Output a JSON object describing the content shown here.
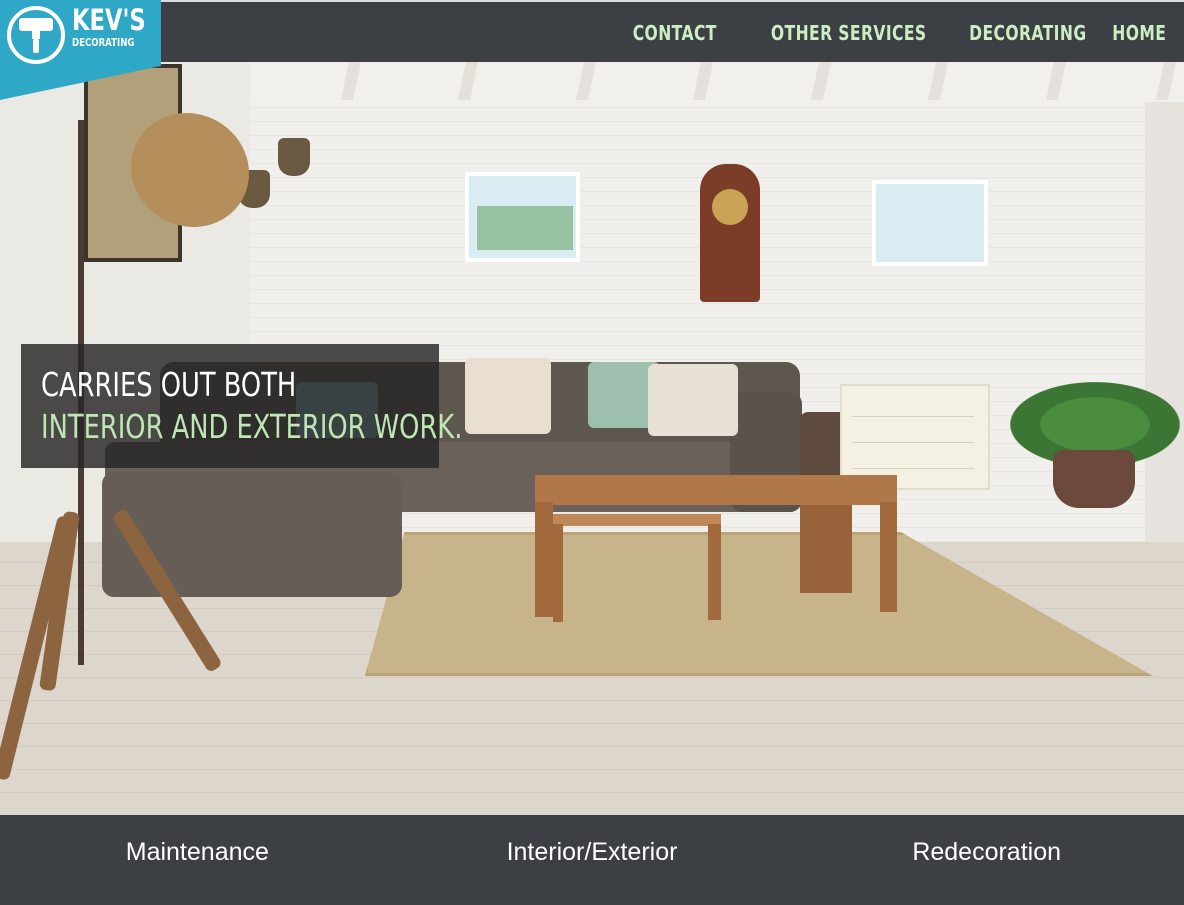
{
  "brand": {
    "title": "KEV'S",
    "subtitle": "DECORATING",
    "accent": "#2fa8c8",
    "logo_icon": "paint-roller-icon"
  },
  "nav": {
    "items": [
      {
        "label": "CONTACT"
      },
      {
        "label": "OTHER SERVICES"
      },
      {
        "label": "DECORATING"
      },
      {
        "label": "HOME"
      }
    ],
    "link_color": "#cdeec2"
  },
  "hero": {
    "caption_line1": "CARRIES OUT BOTH",
    "caption_line2": "INTERIOR AND EXTERIOR WORK.",
    "image_subject": "living-room-photo"
  },
  "services": {
    "items": [
      {
        "label": "Maintenance"
      },
      {
        "label": "Interior/Exterior"
      },
      {
        "label": "Redecoration"
      }
    ]
  },
  "colors": {
    "bar_background": "#3c3f43",
    "caption_background": "#262626",
    "caption_highlight": "#bfe6b4"
  }
}
